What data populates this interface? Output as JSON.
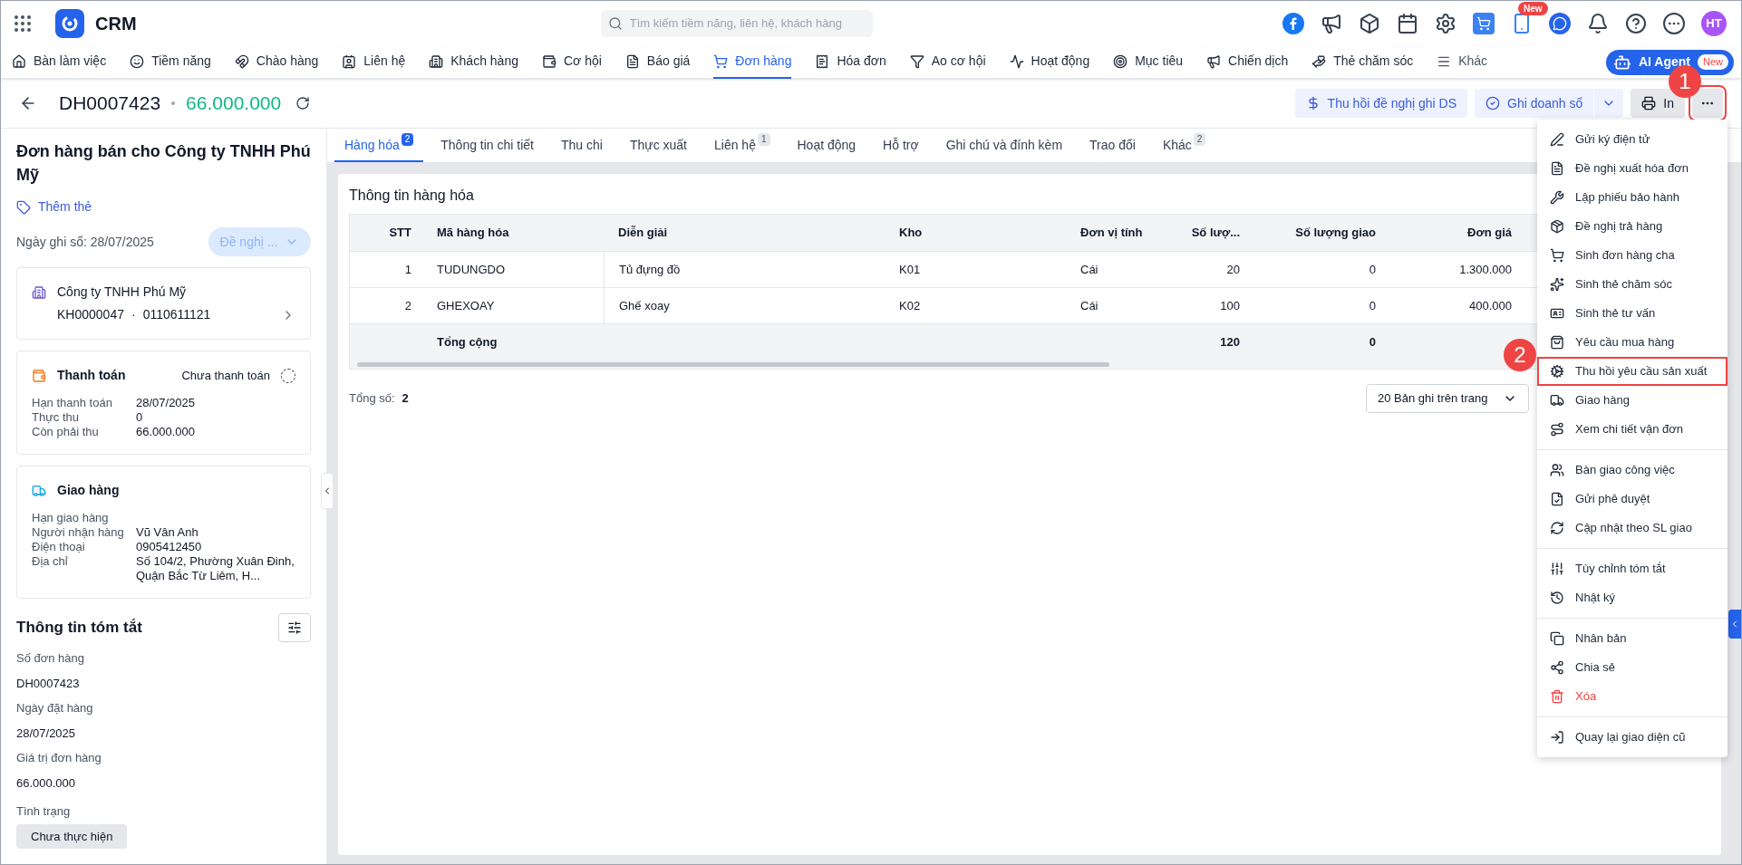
{
  "app": {
    "name": "CRM",
    "search_placeholder": "Tìm kiếm tiềm năng, liên hệ, khách hàng",
    "new_badge": "New",
    "avatar": "HT"
  },
  "nav": [
    {
      "label": "Bàn làm việc",
      "selected": false
    },
    {
      "label": "Tiềm năng",
      "selected": false
    },
    {
      "label": "Chào hàng",
      "selected": false
    },
    {
      "label": "Liên hệ",
      "selected": false
    },
    {
      "label": "Khách hàng",
      "selected": false
    },
    {
      "label": "Cơ hội",
      "selected": false
    },
    {
      "label": "Báo giá",
      "selected": false
    },
    {
      "label": "Đơn hàng",
      "selected": true
    },
    {
      "label": "Hóa đơn",
      "selected": false
    },
    {
      "label": "Ao cơ hội",
      "selected": false
    },
    {
      "label": "Hoạt động",
      "selected": false
    },
    {
      "label": "Mục tiêu",
      "selected": false
    },
    {
      "label": "Chiến dịch",
      "selected": false
    },
    {
      "label": "Thẻ chăm sóc",
      "selected": false
    },
    {
      "label": "Khác",
      "selected": false
    }
  ],
  "ai_agent": {
    "label": "AI Agent",
    "badge": "New"
  },
  "header": {
    "code": "DH0007423",
    "amount": "66.000.000",
    "buttons": [
      "Thu hồi đề nghị ghi DS",
      "Ghi doanh số",
      "In"
    ]
  },
  "left": {
    "title": "Đơn hàng bán cho Công ty TNHH Phú Mỹ",
    "add_tag": "Thêm thẻ",
    "record_date": "Ngày ghi sổ: 28/07/2025",
    "status_button": "Đề nghị ...",
    "customer": {
      "name": "Công ty TNHH Phú Mỹ",
      "code": "KH0000047",
      "separator": "·",
      "tax": "0110611121"
    },
    "payment": {
      "title": "Thanh toán",
      "status": "Chưa thanh toán",
      "rows": [
        [
          "Hạn thanh toán",
          "28/07/2025"
        ],
        [
          "Thực thu",
          "0"
        ],
        [
          "Còn phải thu",
          "66.000.000"
        ]
      ]
    },
    "delivery": {
      "title": "Giao hàng",
      "rows": [
        [
          "Hạn giao hàng",
          ""
        ],
        [
          "Người nhận hàng",
          "Vũ Vân Anh"
        ],
        [
          "Điện thoại",
          "0905412450"
        ],
        [
          "Địa chỉ",
          "Số 104/2, Phường Xuân Đinh, Quận Bắc Từ Liêm, H..."
        ]
      ]
    },
    "summary": {
      "title": "Thông tin tóm tắt",
      "fields": [
        [
          "Số đơn hàng",
          "DH0007423"
        ],
        [
          "Ngày đặt hàng",
          "28/07/2025"
        ],
        [
          "Giá trị đơn hàng",
          "66.000.000"
        ]
      ],
      "state_label": "Tình trạng",
      "state": "Chưa thực hiện"
    }
  },
  "tabs": [
    {
      "label": "Hàng hóa",
      "badge": "2",
      "selected": true
    },
    {
      "label": "Thông tin chi tiết",
      "selected": false
    },
    {
      "label": "Thu chi",
      "selected": false
    },
    {
      "label": "Thực xuất",
      "selected": false
    },
    {
      "label": "Liên hệ",
      "badge": "1",
      "selected": false
    },
    {
      "label": "Hoạt động",
      "selected": false
    },
    {
      "label": "Hỗ trợ",
      "selected": false
    },
    {
      "label": "Ghi chú và đính kèm",
      "selected": false
    },
    {
      "label": "Trao đổi",
      "selected": false
    },
    {
      "label": "Khác",
      "badge": "2",
      "selected": false
    }
  ],
  "goods": {
    "title": "Thông tin hàng hóa",
    "columns": [
      "STT",
      "Mã hàng hóa",
      "Diễn giải",
      "Kho",
      "Đơn vị tính",
      "Số lượ...",
      "Số lượng giao",
      "Đơn giá"
    ],
    "rows": [
      [
        "1",
        "TUDUNGDO",
        "Tủ đựng đồ",
        "K01",
        "Cái",
        "20",
        "0",
        "1.300.000"
      ],
      [
        "2",
        "GHEXOAY",
        "Ghế xoay",
        "K02",
        "Cái",
        "100",
        "0",
        "400.000"
      ]
    ],
    "total": {
      "label": "Tổng cộng",
      "quantity": "120",
      "delivered": "0"
    },
    "count_label": "Tổng số:",
    "count": "2",
    "page_size": "20 Bản ghi trên trang"
  },
  "menu": [
    [
      {
        "label": "Gửi ký điện tử",
        "kind": "normal",
        "highlighted": false
      },
      {
        "label": "Đề nghị xuất hóa đơn",
        "kind": "normal",
        "highlighted": false
      },
      {
        "label": "Lập phiếu bảo hành",
        "kind": "normal",
        "highlighted": false
      },
      {
        "label": "Đề nghị trả hàng",
        "kind": "normal",
        "highlighted": false
      },
      {
        "label": "Sinh đơn hàng cha",
        "kind": "normal",
        "highlighted": false
      },
      {
        "label": "Sinh thẻ chăm sóc",
        "kind": "normal",
        "highlighted": false
      },
      {
        "label": "Sinh thẻ tư vấn",
        "kind": "normal",
        "highlighted": false
      },
      {
        "label": "Yêu cầu mua hàng",
        "kind": "normal",
        "highlighted": false
      },
      {
        "label": "Thu hồi yêu cầu sản xuất",
        "kind": "normal",
        "highlighted": true
      },
      {
        "label": "Giao hàng",
        "kind": "normal",
        "highlighted": false
      },
      {
        "label": "Xem chi tiết vận đơn",
        "kind": "normal",
        "highlighted": false
      }
    ],
    [
      {
        "label": "Bàn giao công việc",
        "kind": "normal",
        "highlighted": false
      },
      {
        "label": "Gửi phê duyệt",
        "kind": "normal",
        "highlighted": false
      },
      {
        "label": "Cập nhật theo SL giao",
        "kind": "normal",
        "highlighted": false
      }
    ],
    [
      {
        "label": "Tùy chỉnh tóm tắt",
        "kind": "normal",
        "highlighted": false
      },
      {
        "label": "Nhật ký",
        "kind": "normal",
        "highlighted": false
      }
    ],
    [
      {
        "label": "Nhân bản",
        "kind": "normal",
        "highlighted": false
      },
      {
        "label": "Chia sẻ",
        "kind": "normal",
        "highlighted": false
      },
      {
        "label": "Xóa",
        "kind": "danger",
        "highlighted": false
      }
    ],
    [
      {
        "label": "Quay lại giao diện cũ",
        "kind": "normal",
        "highlighted": false
      }
    ]
  ],
  "annotations": [
    "1",
    "2"
  ]
}
